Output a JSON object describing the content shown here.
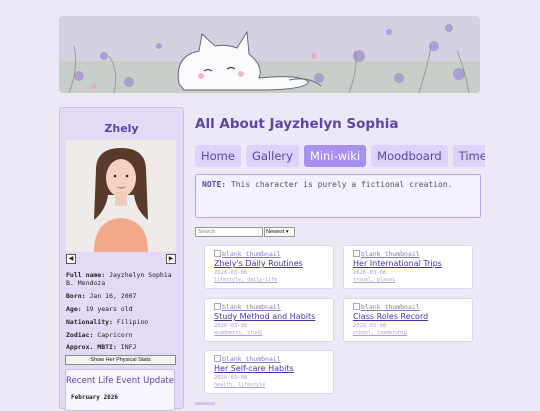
{
  "sidebar": {
    "title": "Zhely",
    "prev_glyph": "◀",
    "next_glyph": "▶",
    "info": [
      {
        "label": "Full name:",
        "value": "Jayzhelyn Sophia B. Mendoza"
      },
      {
        "label": "Born:",
        "value": "Jan 16, 2007"
      },
      {
        "label": "Age:",
        "value": "19 years old"
      },
      {
        "label": "Nationality:",
        "value": "Filipino"
      },
      {
        "label": "Zodiac:",
        "value": "Capricorn"
      },
      {
        "label": "Approx. MBTI:",
        "value": "INFJ"
      }
    ],
    "stats_button": "Show Her Physical Stats",
    "event_title": "Recent Life Event Update",
    "event_date": "February 2026"
  },
  "main": {
    "title": "All About Jayzhelyn Sophia",
    "tabs": [
      {
        "label": "Home",
        "active": false
      },
      {
        "label": "Gallery",
        "active": false
      },
      {
        "label": "Mini-wiki",
        "active": true
      },
      {
        "label": "Moodboard",
        "active": false
      },
      {
        "label": "Time",
        "active": false
      }
    ],
    "note_label": "NOTE:",
    "note_text": "This character is purely a fictional creation.",
    "search_placeholder": "Search",
    "sort_value": "Newest",
    "thumb_alt": "blank thumbnail",
    "cards": [
      {
        "title": "Zhely's Daily Routines",
        "date": "2026-03-08",
        "tags": "lifestyle, daily-life"
      },
      {
        "title": "Her International Trips",
        "date": "2026-03-08",
        "tags": "travel, places"
      },
      {
        "title": "Study Method and Habits",
        "date": "2026-03-08",
        "tags": "academics, study"
      },
      {
        "title": "Class Roles Record",
        "date": "2026-03-08",
        "tags": "school, leadership"
      },
      {
        "title": "Her Self-care Habits",
        "date": "2026-03-08",
        "tags": "health, lifestyle"
      }
    ]
  },
  "colors": {
    "accent": "#5a46a8",
    "tab_active": "#a890f0",
    "tab_bg": "#ddd2fb",
    "page_bg": "#ece8f6"
  }
}
